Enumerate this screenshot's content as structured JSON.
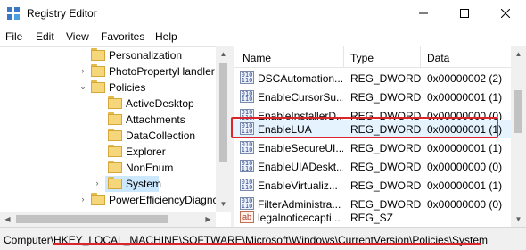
{
  "window": {
    "title": "Registry Editor"
  },
  "menu": [
    "File",
    "Edit",
    "View",
    "Favorites",
    "Help"
  ],
  "tree": {
    "items": [
      {
        "label": "Personalization"
      },
      {
        "label": "PhotoPropertyHandler"
      },
      {
        "label": "Policies"
      },
      {
        "label": "ActiveDesktop"
      },
      {
        "label": "Attachments"
      },
      {
        "label": "DataCollection"
      },
      {
        "label": "Explorer"
      },
      {
        "label": "NonEnum"
      },
      {
        "label": "System"
      },
      {
        "label": "PowerEfficiencyDiagnc"
      }
    ]
  },
  "list": {
    "columns": {
      "name": "Name",
      "type": "Type",
      "data": "Data"
    },
    "rows": [
      {
        "name": "DSCAutomation...",
        "type": "REG_DWORD",
        "data": "0x00000002 (2)",
        "icon": "dword-icon"
      },
      {
        "name": "EnableCursorSu...",
        "type": "REG_DWORD",
        "data": "0x00000001 (1)",
        "icon": "dword-icon"
      },
      {
        "name": "EnableInstallerD...",
        "type": "REG_DWORD",
        "data": "0x00000000 (0)",
        "icon": "dword-icon"
      },
      {
        "name": "EnableLUA",
        "type": "REG_DWORD",
        "data": "0x00000001 (1)",
        "icon": "dword-icon"
      },
      {
        "name": "EnableSecureUI...",
        "type": "REG_DWORD",
        "data": "0x00000001 (1)",
        "icon": "dword-icon"
      },
      {
        "name": "EnableUIADeskt...",
        "type": "REG_DWORD",
        "data": "0x00000000 (0)",
        "icon": "dword-icon"
      },
      {
        "name": "EnableVirtualiz...",
        "type": "REG_DWORD",
        "data": "0x00000001 (1)",
        "icon": "dword-icon"
      },
      {
        "name": "FilterAdministra...",
        "type": "REG_DWORD",
        "data": "0x00000000 (0)",
        "icon": "dword-icon"
      },
      {
        "name": "legalnoticecapti...",
        "type": "REG_SZ",
        "data": "",
        "icon": "string-icon"
      }
    ]
  },
  "status": {
    "prefix": "Computer\\",
    "path": "HKEY_LOCAL_MACHINE\\SOFTWARE\\Microsoft\\Windows\\CurrentVersion\\Policies\\System"
  },
  "colors": {
    "highlight": "#d9262c",
    "selection": "#cce8ff",
    "folder": "#f6d67a"
  }
}
